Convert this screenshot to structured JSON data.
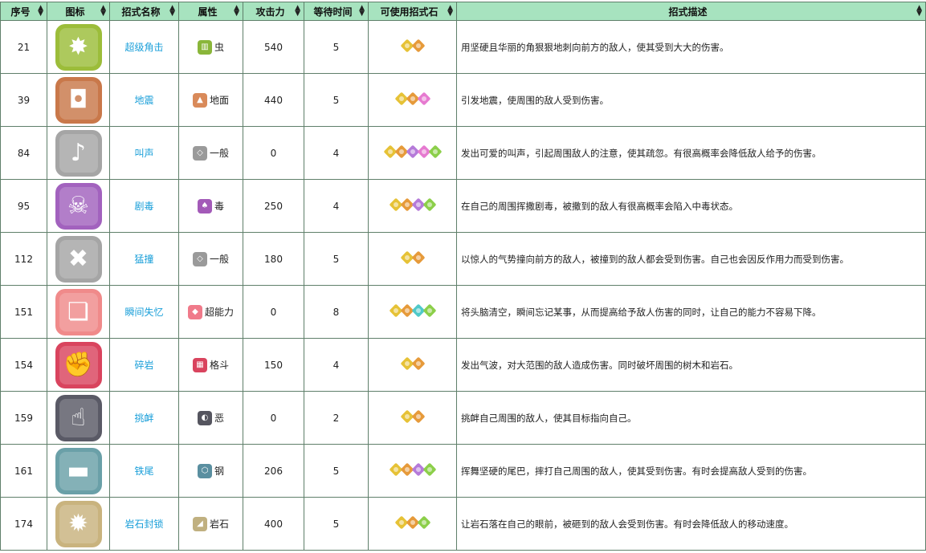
{
  "headers": {
    "idx": "序号",
    "icon": "图标",
    "name": "招式名称",
    "attr": "属性",
    "power": "攻击力",
    "wait": "等待时间",
    "stones": "可使用招式石",
    "desc": "招式描述"
  },
  "rows": [
    {
      "idx": "21",
      "name": "超级角击",
      "attr": "虫",
      "power": "540",
      "wait": "5",
      "icon": "spiky-burst-icon",
      "icon_color": "#9cbd3a",
      "attr_icon": "bug-type-icon",
      "attr_color": "#8ab63a",
      "stones": [
        "#e6c236",
        "#e69a3a"
      ],
      "desc": "用坚硬且华丽的角狠狠地刺向前方的敌人，使其受到大大的伤害。"
    },
    {
      "idx": "39",
      "name": "地震",
      "attr": "地面",
      "power": "440",
      "wait": "5",
      "icon": "ground-quake-icon",
      "icon_color": "#c9784a",
      "attr_icon": "ground-type-icon",
      "attr_color": "#d98a5a",
      "stones": [
        "#e6c236",
        "#e69a3a",
        "#e67ad0"
      ],
      "desc": "引发地震，使周围的敌人受到伤害。"
    },
    {
      "idx": "84",
      "name": "叫声",
      "attr": "一般",
      "power": "0",
      "wait": "4",
      "icon": "growl-icon",
      "icon_color": "#a5a5a5",
      "attr_icon": "normal-type-icon",
      "attr_color": "#9a9a9a",
      "stones": [
        "#e6c236",
        "#e69a3a",
        "#b57ad9",
        "#e67ad0",
        "#8ccf4a"
      ],
      "desc": "发出可爱的叫声，引起周围敌人的注意，使其疏忽。有很高概率会降低敌人给予的伤害。"
    },
    {
      "idx": "95",
      "name": "剧毒",
      "attr": "毒",
      "power": "250",
      "wait": "4",
      "icon": "toxic-icon",
      "icon_color": "#a262be",
      "attr_icon": "poison-type-icon",
      "attr_color": "#a35ab8",
      "stones": [
        "#e6c236",
        "#e69a3a",
        "#b57ad9",
        "#8ccf4a"
      ],
      "desc": "在自己的周围挥撒剧毒，被撒到的敌人有很高概率会陷入中毒状态。"
    },
    {
      "idx": "112",
      "name": "猛撞",
      "attr": "一般",
      "power": "180",
      "wait": "5",
      "icon": "take-down-icon",
      "icon_color": "#a5a5a5",
      "attr_icon": "normal-type-icon",
      "attr_color": "#9a9a9a",
      "stones": [
        "#e6c236",
        "#e69a3a"
      ],
      "desc": "以惊人的气势撞向前方的敌人，被撞到的敌人都会受到伤害。自己也会因反作用力而受到伤害。"
    },
    {
      "idx": "151",
      "name": "瞬间失忆",
      "attr": "超能力",
      "power": "0",
      "wait": "8",
      "icon": "amnesia-icon",
      "icon_color": "#f08a8a",
      "attr_icon": "psychic-type-icon",
      "attr_color": "#f07a8a",
      "stones": [
        "#e6c236",
        "#e69a3a",
        "#4fc9c9",
        "#8ccf4a"
      ],
      "desc": "将头脑清空，瞬间忘记某事，从而提高给予敌人伤害的同时，让自己的能力不容易下降。"
    },
    {
      "idx": "154",
      "name": "碎岩",
      "attr": "格斗",
      "power": "150",
      "wait": "4",
      "icon": "rock-smash-icon",
      "icon_color": "#d9445e",
      "attr_icon": "fighting-type-icon",
      "attr_color": "#d9445e",
      "stones": [
        "#e6c236",
        "#e69a3a"
      ],
      "desc": "发出气波，对大范围的敌人造成伤害。同时破坏周围的树木和岩石。"
    },
    {
      "idx": "159",
      "name": "挑衅",
      "attr": "恶",
      "power": "0",
      "wait": "2",
      "icon": "taunt-hand-icon",
      "icon_color": "#5a5a66",
      "attr_icon": "dark-type-icon",
      "attr_color": "#55555f",
      "stones": [
        "#e6c236",
        "#e69a3a"
      ],
      "desc": "挑衅自己周围的敌人，使其目标指向自己。"
    },
    {
      "idx": "161",
      "name": "铁尾",
      "attr": "钢",
      "power": "206",
      "wait": "5",
      "icon": "iron-tail-icon",
      "icon_color": "#6aa0a8",
      "attr_icon": "steel-type-icon",
      "attr_color": "#5a8fa0",
      "stones": [
        "#e6c236",
        "#e69a3a",
        "#b57ad9",
        "#8ccf4a"
      ],
      "desc": "挥舞坚硬的尾巴，摔打自己周围的敌人，使其受到伤害。有时会提高敌人受到的伤害。"
    },
    {
      "idx": "174",
      "name": "岩石封锁",
      "attr": "岩石",
      "power": "400",
      "wait": "5",
      "icon": "rock-tomb-icon",
      "icon_color": "#c9b37e",
      "attr_icon": "rock-type-icon",
      "attr_color": "#c0b080",
      "stones": [
        "#e6c236",
        "#e69a3a",
        "#8ccf4a"
      ],
      "desc": "让岩石落在自己的眼前，被砸到的敌人会受到伤害。有时会降低敌人的移动速度。"
    }
  ]
}
